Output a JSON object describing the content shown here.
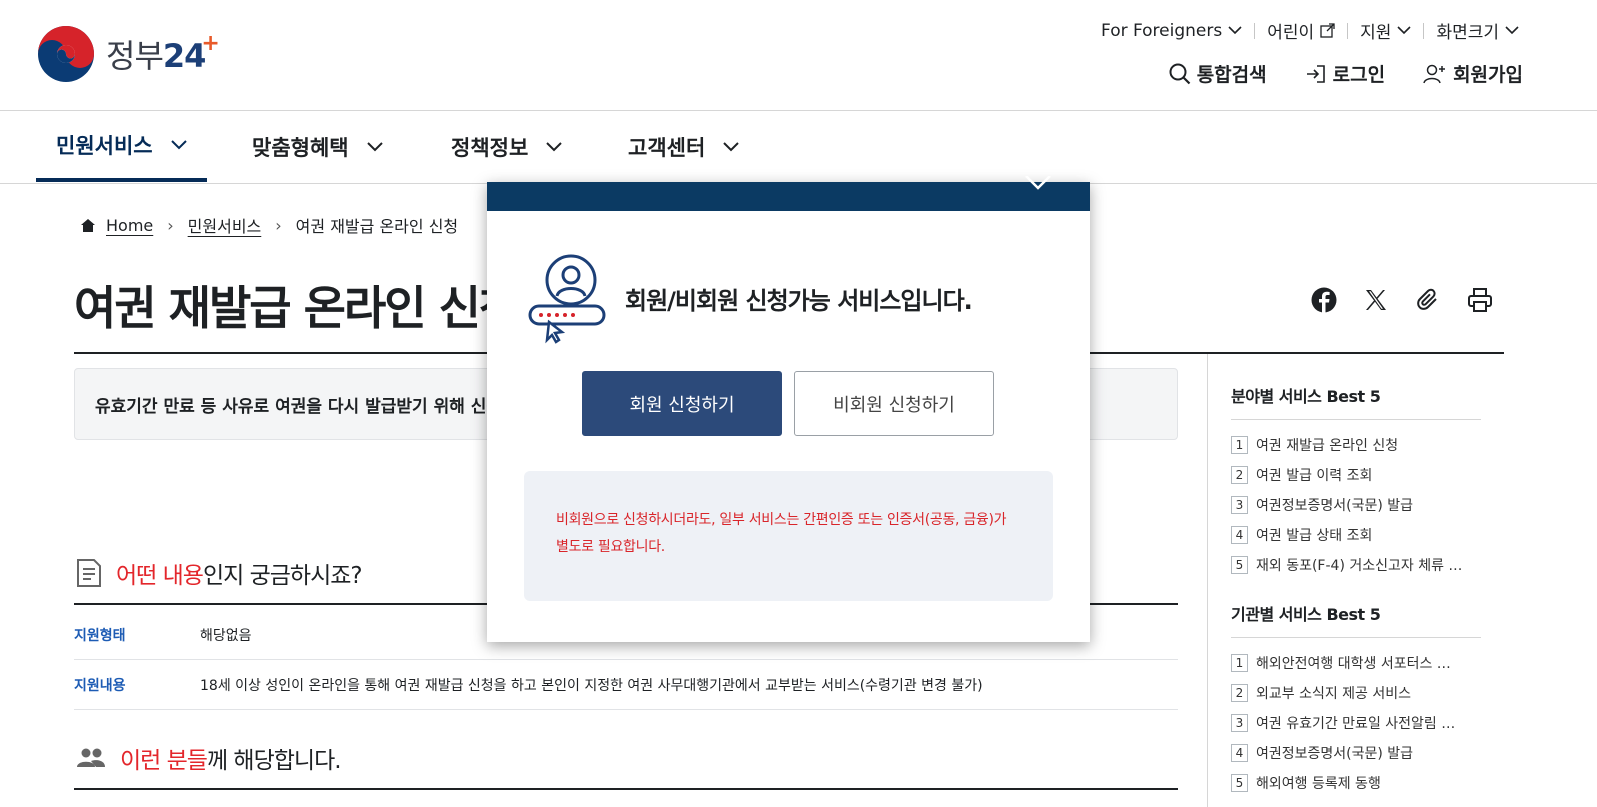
{
  "header": {
    "logo_text": "정부",
    "logo_number": "24",
    "logo_plus": "+",
    "util": {
      "foreigners": "For Foreigners",
      "kids": "어린이",
      "support": "지원",
      "screen_size": "화면크기"
    },
    "actions": {
      "search": "통합검색",
      "login": "로그인",
      "signup": "회원가입"
    }
  },
  "gnb": {
    "items": [
      {
        "label": "민원서비스"
      },
      {
        "label": "맞춤형혜택"
      },
      {
        "label": "정책정보"
      },
      {
        "label": "고객센터"
      }
    ]
  },
  "breadcrumb": {
    "home": "Home",
    "level1": "민원서비스",
    "current": "여권 재발급 온라인 신청"
  },
  "page": {
    "title": "여권 재발급 온라인 신청",
    "summary": "유효기간 만료 등 사유로 여권을 다시 발급받기 위해 신청하는 서비스입니다."
  },
  "section1": {
    "highlight": "어떤 내용",
    "rest": "인지 궁금하시죠?",
    "rows": [
      {
        "label": "지원형태",
        "value": "해당없음"
      },
      {
        "label": "지원내용",
        "value": "18세 이상 성인이 온라인을 통해 여권 재발급 신청을 하고 본인이 지정한 여권 사무대행기관에서 교부받는 서비스(수령기관 변경 불가)"
      }
    ]
  },
  "section2": {
    "highlight": "이런 분들",
    "rest": "께 해당합니다."
  },
  "sidebar": {
    "field_title": "분야별 서비스 Best 5",
    "field_items": [
      {
        "rank": "1",
        "label": "여권 재발급 온라인 신청"
      },
      {
        "rank": "2",
        "label": "여권 발급 이력 조회"
      },
      {
        "rank": "3",
        "label": "여권정보증명서(국문) 발급"
      },
      {
        "rank": "4",
        "label": "여권 발급 상태 조회"
      },
      {
        "rank": "5",
        "label": "재외 동포(F-4) 거소신고자 체류 …"
      }
    ],
    "agency_title": "기관별 서비스 Best 5",
    "agency_items": [
      {
        "rank": "1",
        "label": "해외안전여행 대학생 서포터스 …"
      },
      {
        "rank": "2",
        "label": "외교부 소식지 제공 서비스"
      },
      {
        "rank": "3",
        "label": "여권 유효기간 만료일 사전알림 …"
      },
      {
        "rank": "4",
        "label": "여권정보증명서(국문) 발급"
      },
      {
        "rank": "5",
        "label": "해외여행 등록제 동행"
      }
    ]
  },
  "modal": {
    "message": "회원/비회원 신청가능 서비스입니다.",
    "member_button": "회원 신청하기",
    "guest_button": "비회원 신청하기",
    "notice": "비회원으로 신청하시더라도, 일부 서비스는 간편인증 또는 인증서(공동, 금융)가 별도로 필요합니다."
  },
  "colors": {
    "navy": "#052b57",
    "modal_header": "#0b3a63",
    "primary_button": "#2c4a7a",
    "highlight_red": "#e3262b",
    "label_blue": "#1c5bb4"
  }
}
